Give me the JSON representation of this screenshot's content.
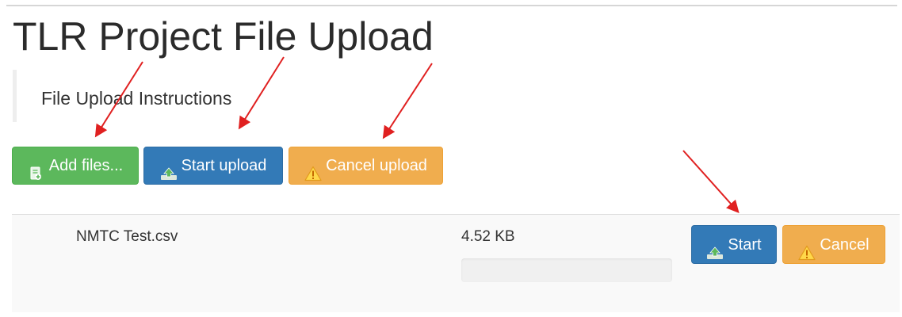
{
  "header": {
    "title": "TLR Project File Upload"
  },
  "instructions": {
    "label": "File Upload Instructions"
  },
  "toolbar": {
    "add_files_label": "Add files...",
    "start_upload_label": "Start upload",
    "cancel_upload_label": "Cancel upload"
  },
  "files": [
    {
      "name": "NMTC Test.csv",
      "size": "4.52 KB",
      "progress": 0,
      "start_label": "Start",
      "cancel_label": "Cancel"
    }
  ],
  "icons": {
    "add_files": "file-add-icon",
    "start": "upload-icon",
    "cancel": "warning-icon"
  },
  "colors": {
    "success": "#5cb85c",
    "primary": "#337ab7",
    "warning": "#f0ad4e",
    "annotation_arrow": "#e02020"
  }
}
